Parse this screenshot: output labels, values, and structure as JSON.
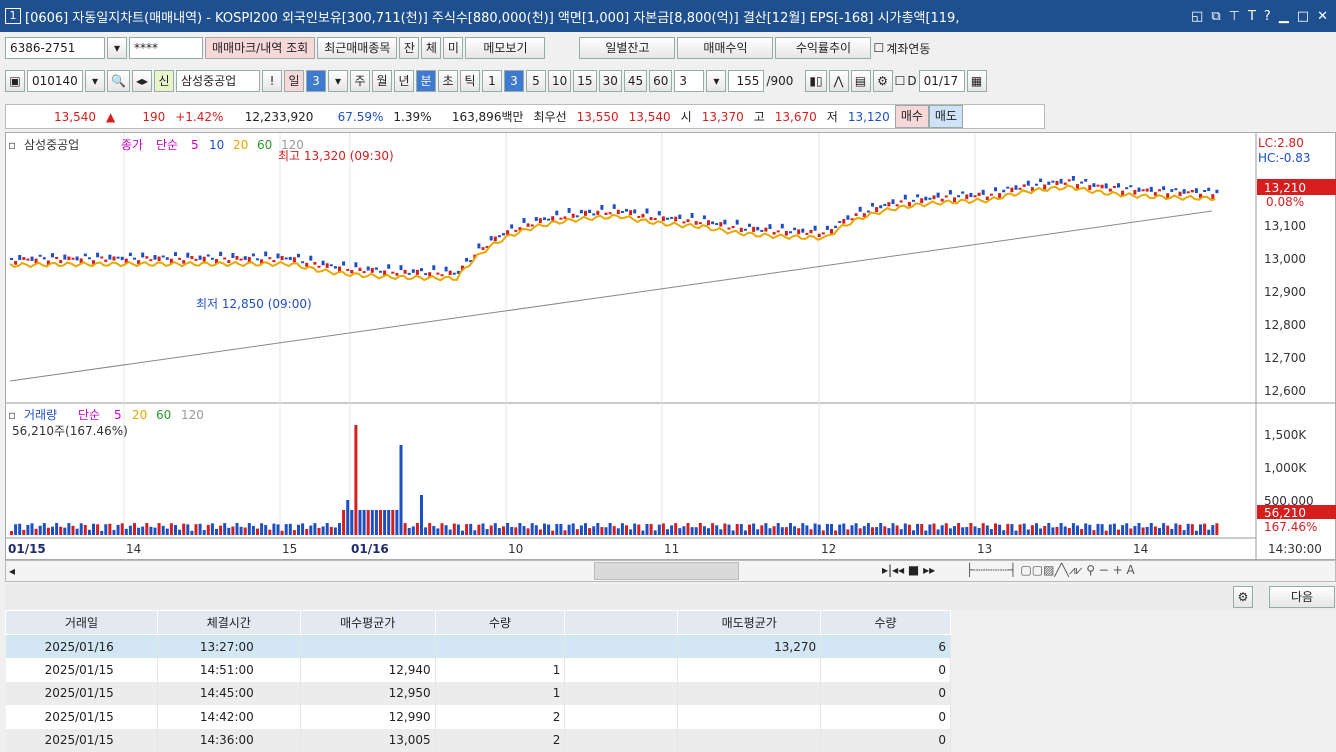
{
  "window": {
    "number": "1",
    "title": "[0606] 자동일지차트(매매내역) - KOSPI200 외국인보유[300,711(천)] 주식수[880,000(천)] 액면[1,000] 자본금[8,800(억)] 결산[12월] EPS[-168] 시가총액[119,"
  },
  "account": {
    "number": "6386-2751",
    "password": "****",
    "btn_mark": "매매마크/내역 조회",
    "btn_recent": "최근매매종목",
    "tab1": "잔",
    "tab2": "체",
    "tab3": "미",
    "btn_memo": "메모보기",
    "btn_daily": "일별잔고",
    "btn_profit": "매매수익",
    "btn_rate": "수익률추이",
    "chk_link": "계좌연동"
  },
  "toolbar": {
    "code": "010140",
    "badge": "신",
    "stock": "삼성중공업",
    "ex": "!",
    "periods": [
      "일",
      "3",
      "주",
      "월",
      "년",
      "분",
      "초",
      "틱",
      "1",
      "3",
      "5",
      "10",
      "15",
      "30",
      "45",
      "60"
    ],
    "count": "3",
    "total": "155",
    "total_max": "/900",
    "d_label": "D",
    "date": "01/17"
  },
  "quote": {
    "price": "13,540",
    "change": "190",
    "pct": "+1.42%",
    "volume": "12,233,920",
    "vol_pct": "67.59%",
    "turn": "1.39%",
    "amount": "163,896백만",
    "best_label": "최우선",
    "ask": "13,550",
    "bid": "13,540",
    "open_l": "시",
    "open": "13,370",
    "high_l": "고",
    "high": "13,670",
    "low_l": "저",
    "low": "13,120",
    "buy": "매수",
    "sell": "매도"
  },
  "chart_data": {
    "type": "candlestick",
    "legend": {
      "name": "삼성중공업",
      "price": "종가",
      "ma": "단순",
      "periods": [
        "5",
        "10",
        "20",
        "60",
        "120"
      ]
    },
    "annotations": {
      "high": "최고 13,320 (09:30)",
      "low": "최저 12,850 (09:00)",
      "lc": "LC:2.80",
      "hc": "HC:-0.83",
      "last": "13,210",
      "last_pct": "0.08%"
    },
    "y_ticks": [
      "13,100",
      "13,000",
      "12,900",
      "12,800",
      "12,700",
      "12,600"
    ],
    "volume": {
      "label": "거래량",
      "ma": "단순",
      "periods": [
        "5",
        "20",
        "60",
        "120"
      ],
      "value": "56,210주(167.46%)",
      "y_ticks": [
        "1,500K",
        "1,000K",
        "500,000"
      ],
      "last": "56,210",
      "last_pct": "167.46%"
    },
    "x_ticks": [
      "01/15",
      "14",
      "15",
      "01/16",
      "10",
      "11",
      "12",
      "13",
      "14"
    ],
    "time": "14:30:00"
  },
  "grid": {
    "next": "다음",
    "headers": [
      "거래일",
      "체결시간",
      "매수평균가",
      "수량",
      "",
      "매도평균가",
      "수량"
    ],
    "rows": [
      [
        "2025/01/16",
        "13:27:00",
        "",
        "",
        "",
        "13,270",
        "6"
      ],
      [
        "2025/01/15",
        "14:51:00",
        "12,940",
        "1",
        "",
        "",
        "0"
      ],
      [
        "2025/01/15",
        "14:45:00",
        "12,950",
        "1",
        "",
        "",
        "0"
      ],
      [
        "2025/01/15",
        "14:42:00",
        "12,990",
        "2",
        "",
        "",
        "0"
      ],
      [
        "2025/01/15",
        "14:36:00",
        "13,005",
        "2",
        "",
        "",
        "0"
      ]
    ]
  }
}
